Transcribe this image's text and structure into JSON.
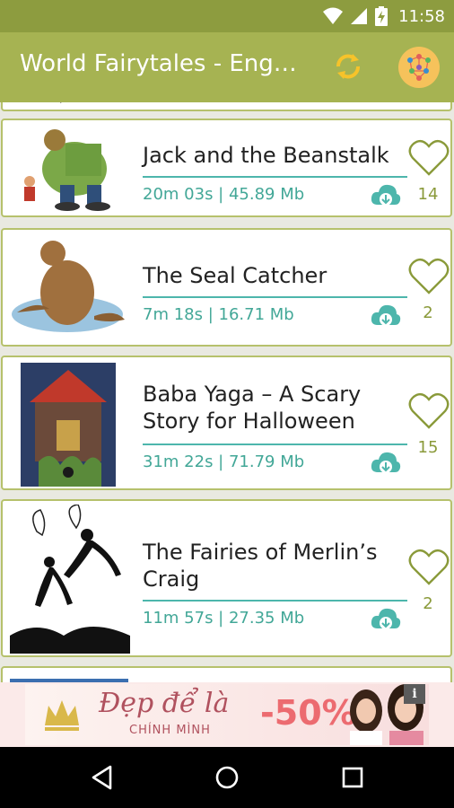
{
  "status_bar": {
    "time": "11:58"
  },
  "app_bar": {
    "title": "World Fairytales - English",
    "sync_icon": "sync-icon",
    "more_icon": "apps-icon"
  },
  "stories": [
    {
      "title": "Jack and the Beanstalk",
      "meta": "20m 03s | 45.89 Mb",
      "likes": "14"
    },
    {
      "title": "The Seal Catcher",
      "meta": "7m 18s | 16.71 Mb",
      "likes": "2"
    },
    {
      "title": "Baba Yaga – A Scary Story for Halloween",
      "meta": "31m 22s | 71.79 Mb",
      "likes": "15"
    },
    {
      "title": "The Fairies of Merlin’s Craig",
      "meta": "11m 57s | 27.35 Mb",
      "likes": "2"
    }
  ],
  "ad": {
    "headline": "Đẹp để là",
    "subline": "CHÍNH MÌNH",
    "discount": "-50%",
    "info_label": "i"
  },
  "colors": {
    "status_bar": "#8d9c3f",
    "app_bar": "#a6b352",
    "accent_teal": "#4db6ac",
    "heart_olive": "#8a9a3a",
    "card_border": "#b6c16c"
  }
}
